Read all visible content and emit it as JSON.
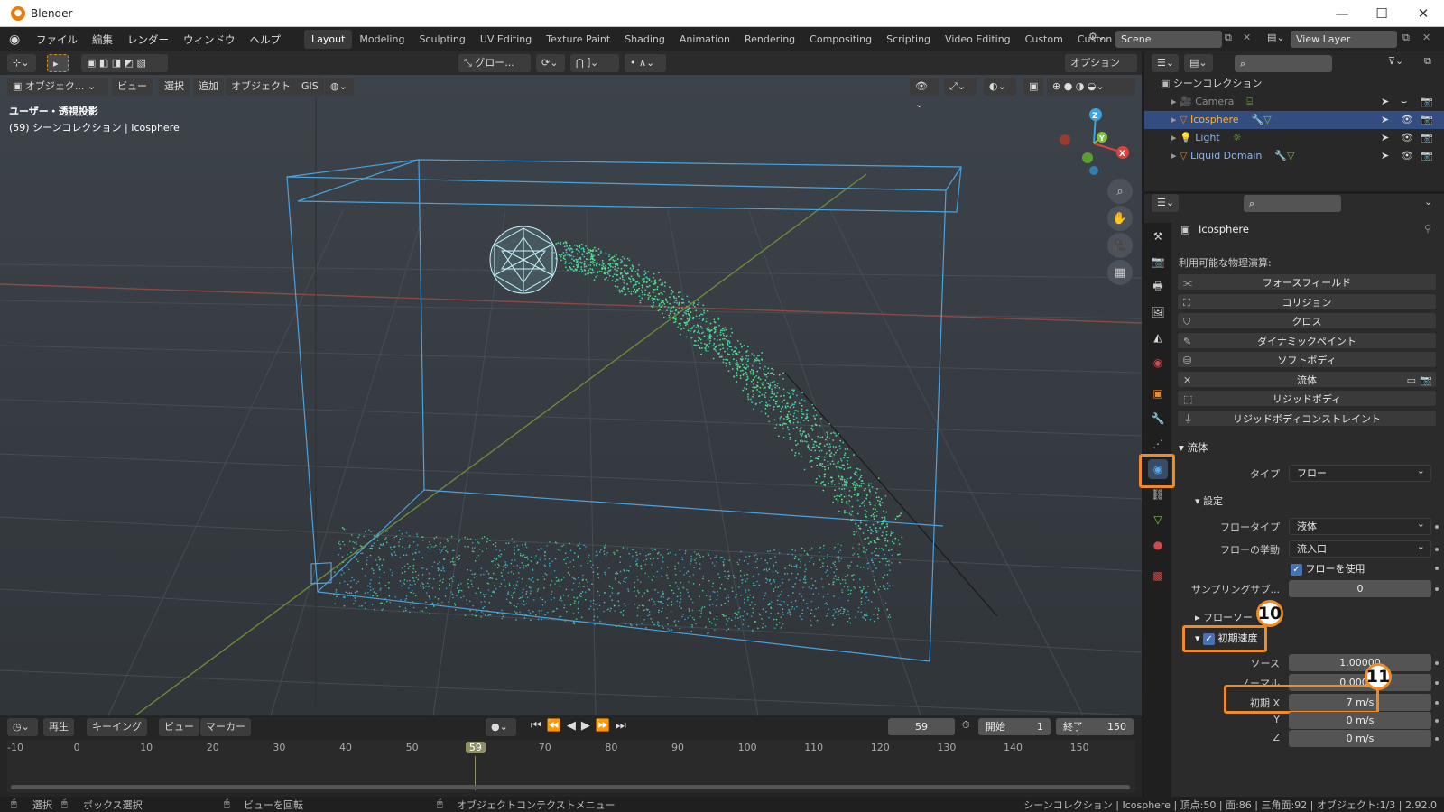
{
  "window": {
    "title": "Blender",
    "min": "—",
    "max": "☐",
    "close": "✕"
  },
  "menus": [
    "ファイル",
    "編集",
    "レンダー",
    "ウィンドウ",
    "ヘルプ"
  ],
  "workspaces": [
    "Layout",
    "Modeling",
    "Sculpting",
    "UV Editing",
    "Texture Paint",
    "Shading",
    "Animation",
    "Rendering",
    "Compositing",
    "Scripting",
    "Video Editing",
    "Custom",
    "Custon"
  ],
  "scene": {
    "name": "Scene",
    "view_layer": "View Layer"
  },
  "viewport_header": {
    "transform": "グロー...",
    "options": "オプション",
    "mode": "オブジェク...",
    "menu": [
      "ビュー",
      "選択",
      "追加",
      "オブジェクト",
      "GIS"
    ]
  },
  "viewport": {
    "view_name": "ユーザー・透視投影",
    "object_info": "(59) シーンコレクション | Icosphere",
    "gizmo": {
      "z": "Z",
      "y": "Y",
      "x": "X"
    }
  },
  "outliner": {
    "collection": "シーンコレクション",
    "items": [
      {
        "name": "Camera",
        "selected": false,
        "dim": true
      },
      {
        "name": "Icosphere",
        "selected": true,
        "dim": false
      },
      {
        "name": "Light",
        "selected": false,
        "dim": false
      },
      {
        "name": "Liquid Domain",
        "selected": false,
        "dim": false
      }
    ]
  },
  "properties": {
    "object_name": "Icosphere",
    "available_physics": "利用可能な物理演算:",
    "physics_buttons": [
      "フォースフィールド",
      "コリジョン",
      "クロス",
      "ダイナミックペイント",
      "ソフトボディ",
      "流体",
      "リジッドボディ",
      "リジッドボディコンストレイント"
    ],
    "fluid_panel": "流体",
    "type_label": "タイプ",
    "type_value": "フロー",
    "settings": "設定",
    "flow_type_label": "フロータイプ",
    "flow_type_value": "液体",
    "flow_behavior_label": "フローの挙動",
    "flow_behavior_value": "流入口",
    "use_flow": "フローを使用",
    "sampling_label": "サンプリングサブ...",
    "sampling_value": "0",
    "flow_source": "フローソー",
    "initial_velocity": "初期速度",
    "source_label": "ソース",
    "source_value": "1.00000",
    "normal_label": "ノーマル",
    "normal_value": "0.00000",
    "init_x_label": "初期 X",
    "init_x_value": "7 m/s",
    "y_label": "Y",
    "y_value": "0 m/s",
    "z_label": "Z",
    "z_value": "0 m/s"
  },
  "annotations": {
    "badge10": "10",
    "badge11": "11",
    "color": "#f08a24"
  },
  "timeline": {
    "menu": [
      "再生",
      "キーイング",
      "ビュー",
      "マーカー"
    ],
    "current_frame": "59",
    "start_label": "開始",
    "start_value": "1",
    "end_label": "終了",
    "end_value": "150",
    "ticks": [
      "-10",
      "0",
      "10",
      "20",
      "30",
      "40",
      "50",
      "59",
      "70",
      "80",
      "90",
      "100",
      "110",
      "120",
      "130",
      "140",
      "150"
    ]
  },
  "statusbar": {
    "select": "選択",
    "box_select": "ボックス選択",
    "rotate": "ビューを回転",
    "context": "オブジェクトコンテクストメニュー",
    "stats": "シーンコレクション | Icosphere | 頂点:50 | 面:86 | 三角面:92 | オブジェクト:1/3 | 2.92.0"
  }
}
